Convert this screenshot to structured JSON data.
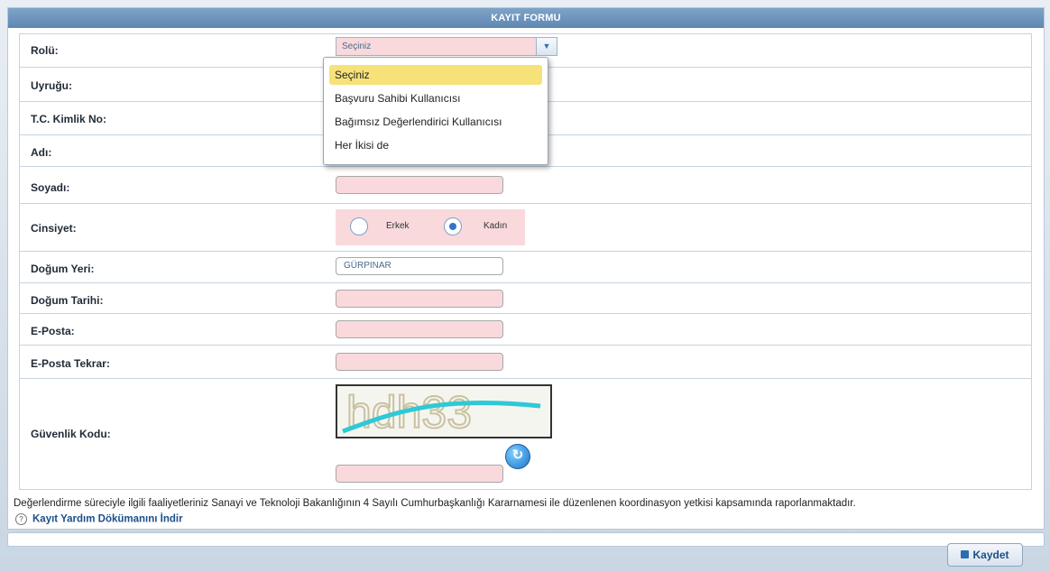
{
  "form": {
    "title": "KAYIT FORMU",
    "role": {
      "label": "Rolü:",
      "value": "Seçiniz",
      "options": [
        "Seçiniz",
        "Başvuru Sahibi Kullanıcısı",
        "Bağımsız Değerlendirici Kullanıcısı",
        "Her İkisi de"
      ]
    },
    "nationality": {
      "label": "Uyruğu:"
    },
    "tc_no": {
      "label": "T.C. Kimlik No:"
    },
    "name": {
      "label": "Adı:"
    },
    "surname": {
      "label": "Soyadı:"
    },
    "gender": {
      "label": "Cinsiyet:",
      "option_male": "Erkek",
      "option_female": "Kadın",
      "selected": "Kadın"
    },
    "birthplace": {
      "label": "Doğum Yeri:",
      "value": "GÜRPINAR"
    },
    "birthdate": {
      "label": "Doğum Tarihi:"
    },
    "email": {
      "label": "E-Posta:"
    },
    "email_repeat": {
      "label": "E-Posta Tekrar:"
    },
    "captcha": {
      "label": "Güvenlik Kodu:",
      "code_text": "hdh33"
    }
  },
  "note": "Değerlendirme süreciyle ilgili faaliyetleriniz Sanayi ve Teknoloji Bakanlığının 4 Sayılı Cumhurbaşkanlığı Kararnamesi ile düzenlenen koordinasyon yetkisi kapsamında raporlanmaktadır.",
  "help_link": "Kayıt Yardım Dökümanını İndir",
  "save_label": "Kaydet",
  "colors": {
    "required_field": "#f9d9dc",
    "header": "#6a90ba",
    "highlight": "#f7e27a"
  },
  "icons": {
    "dropdown_arrow": "chevron-down-icon",
    "refresh": "refresh-icon",
    "help": "question-icon",
    "save": "floppy-disk-icon"
  }
}
